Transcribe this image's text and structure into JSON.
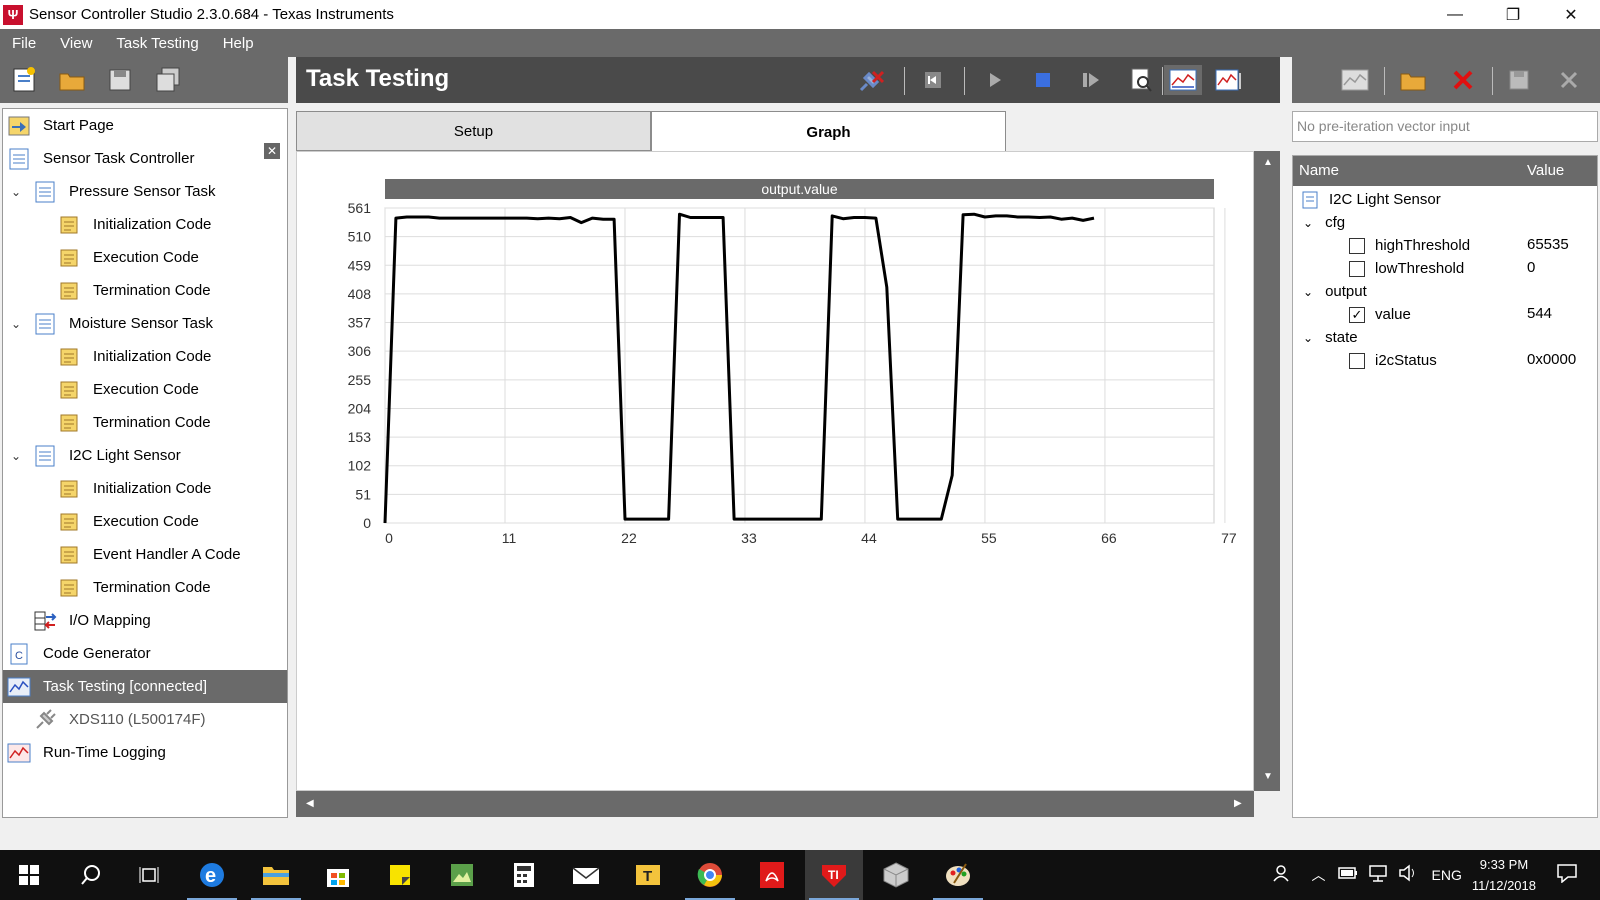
{
  "window": {
    "title": "Sensor Controller Studio 2.3.0.684 - Texas Instruments"
  },
  "menu": [
    "File",
    "View",
    "Task Testing",
    "Help"
  ],
  "sidebar": {
    "start_page": "Start Page",
    "controller": "Sensor Task Controller",
    "pressure_task": "Pressure Sensor Task",
    "moisture_task": "Moisture Sensor Task",
    "light_task": "I2C Light Sensor",
    "init_code": "Initialization Code",
    "exec_code": "Execution Code",
    "term_code": "Termination Code",
    "event_code": "Event Handler A Code",
    "io_mapping": "I/O Mapping",
    "code_generator": "Code Generator",
    "task_testing": "Task Testing [connected]",
    "debugger": "XDS110 (L500174F)",
    "runtime_logging": "Run-Time Logging"
  },
  "main": {
    "title": "Task Testing",
    "tabs": [
      "Setup",
      "Graph"
    ]
  },
  "chart_data": {
    "type": "line",
    "title": "output.value",
    "xlabel": "",
    "ylabel": "",
    "xlim": [
      0,
      76
    ],
    "ylim": [
      0,
      561
    ],
    "xticks": [
      0,
      11,
      22,
      33,
      44,
      55,
      66,
      77
    ],
    "yticks": [
      0,
      51,
      102,
      153,
      204,
      255,
      306,
      357,
      408,
      459,
      510,
      561
    ],
    "grid": true,
    "series": [
      {
        "x": [
          0,
          1,
          2,
          3,
          4,
          5,
          6,
          7,
          8,
          9,
          10,
          11,
          12,
          13,
          14,
          15,
          16,
          17,
          18,
          19,
          20,
          21,
          22,
          23,
          24,
          25,
          26,
          27,
          28,
          29,
          30,
          31,
          32,
          33,
          34,
          35,
          36,
          37,
          38,
          39,
          40,
          41,
          42,
          43,
          44,
          45,
          46,
          47,
          48,
          49,
          50,
          51,
          52,
          53,
          54,
          55,
          56,
          57,
          58,
          59,
          60,
          61,
          62,
          63,
          64,
          65
        ],
        "values": [
          0,
          543,
          545,
          545,
          545,
          543,
          543,
          543,
          543,
          543,
          543,
          543,
          543,
          543,
          542,
          543,
          542,
          544,
          535,
          543,
          541,
          541,
          7,
          7,
          7,
          7,
          7,
          550,
          544,
          544,
          544,
          544,
          7,
          7,
          7,
          7,
          7,
          7,
          7,
          7,
          7,
          547,
          542,
          544,
          544,
          543,
          420,
          7,
          7,
          7,
          7,
          7,
          85,
          549,
          550,
          545,
          547,
          547,
          545,
          545,
          544,
          545,
          541,
          543,
          539,
          543
        ]
      }
    ]
  },
  "vector_input": {
    "placeholder": "No pre-iteration vector input"
  },
  "vars": {
    "header_name": "Name",
    "header_value": "Value",
    "task": "I2C Light Sensor",
    "cfg": "cfg",
    "high": "highThreshold",
    "high_val": "65535",
    "low": "lowThreshold",
    "low_val": "0",
    "output": "output",
    "value": "value",
    "value_val": "544",
    "state": "state",
    "i2c": "i2cStatus",
    "i2c_val": "0x0000"
  },
  "taskbar": {
    "lang": "ENG",
    "time": "9:33 PM",
    "date": "11/12/2018"
  },
  "colors": {
    "accent": "#c8102e",
    "toolbar": "#6a6a6a",
    "header": "#4a4a4a"
  }
}
